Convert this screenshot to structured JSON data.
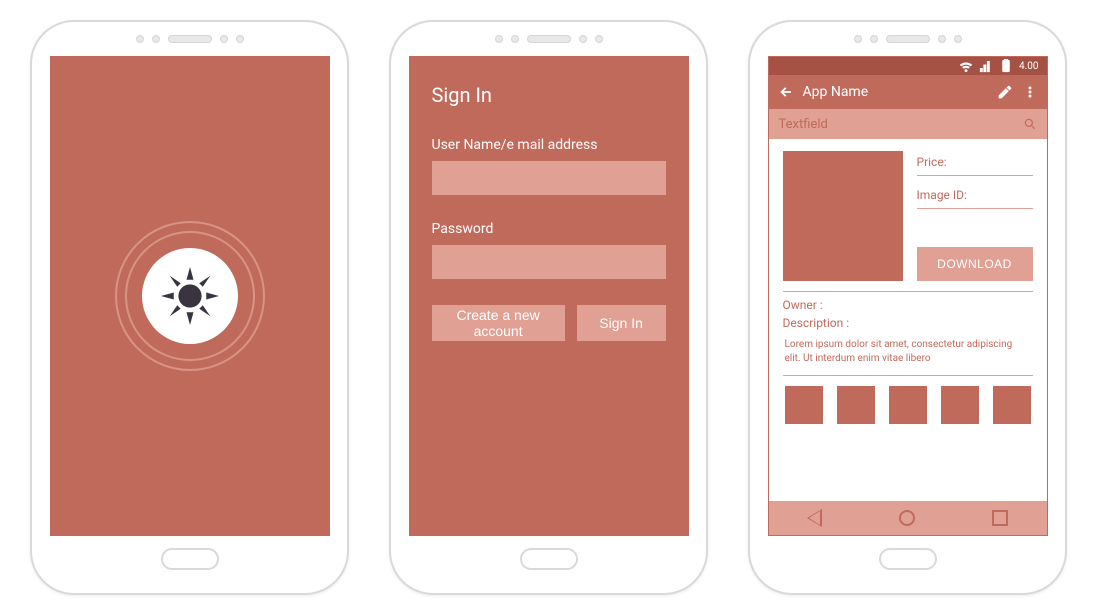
{
  "screen2": {
    "title": "Sign In",
    "user_label": "User Name/e mail address",
    "pass_label": "Password",
    "create_btn": "Create a new account",
    "signin_btn": "Sign In"
  },
  "screen3": {
    "status_time": "4.00",
    "app_title": "App Name",
    "search_placeholder": "Textfield",
    "price_label": "Price:",
    "imageid_label": "Image ID:",
    "download_btn": "DOWNLOAD",
    "owner_label": "Owner :",
    "description_label": "Description :",
    "description_body": "Lorem ipsum dolor sit amet, consectetur adipiscing elit. Ut interdum enim vitae libero"
  }
}
